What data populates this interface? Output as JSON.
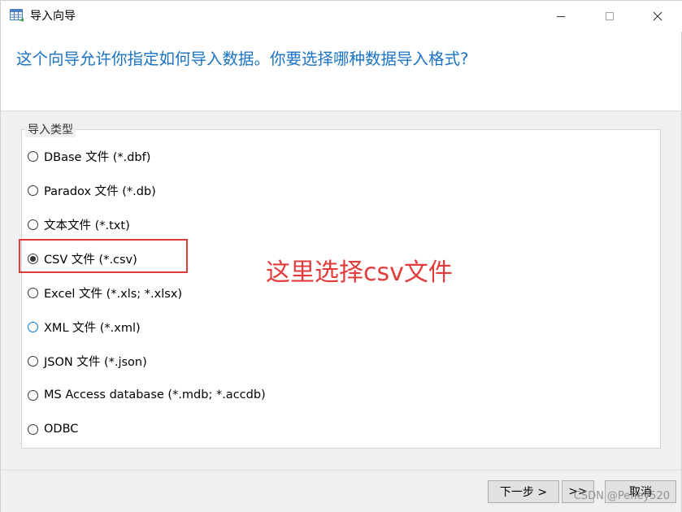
{
  "window": {
    "title": "导入向导",
    "icons": {
      "app": "table-import-icon",
      "minimize": "minimize-icon",
      "maximize": "maximize-icon",
      "close": "close-icon"
    }
  },
  "header": {
    "text": "这个向导允许你指定如何导入数据。你要选择哪种数据导入格式?"
  },
  "import_type": {
    "legend": "导入类型",
    "options": [
      {
        "label": "DBase 文件 (*.dbf)",
        "selected": false
      },
      {
        "label": "Paradox 文件 (*.db)",
        "selected": false
      },
      {
        "label": "文本文件 (*.txt)",
        "selected": false
      },
      {
        "label": "CSV 文件 (*.csv)",
        "selected": true
      },
      {
        "label": "Excel 文件 (*.xls; *.xlsx)",
        "selected": false
      },
      {
        "label": "XML 文件 (*.xml)",
        "selected": false
      },
      {
        "label": "JSON 文件 (*.json)",
        "selected": false
      },
      {
        "label": "MS Access database (*.mdb; *.accdb)",
        "selected": false
      },
      {
        "label": "ODBC",
        "selected": false
      }
    ]
  },
  "annotation": {
    "text": "这里选择csv文件",
    "color": "#e23b3b"
  },
  "footer": {
    "next_label": "下一步 >",
    "finish_label": ">>",
    "cancel_label": "取消",
    "watermark": "CSDN @Pefley520"
  },
  "colors": {
    "accent": "#1a73c4",
    "annotation_red": "#e23b3b"
  }
}
